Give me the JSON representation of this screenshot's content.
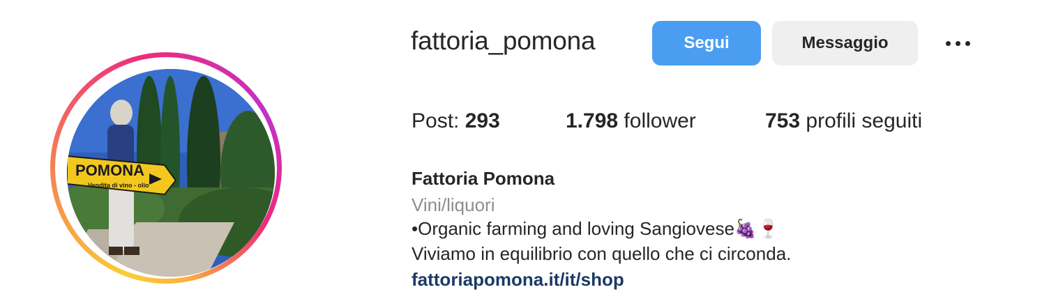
{
  "profile": {
    "username": "fattoria_pomona",
    "avatar_sign_main": "POMONA",
    "avatar_sign_sub": "Vendita di vino - olio"
  },
  "actions": {
    "follow_label": "Segui",
    "message_label": "Messaggio",
    "more_icon": "more-horizontal-icon"
  },
  "stats": {
    "posts_label": "Post:",
    "posts_count": "293",
    "followers_count": "1.798",
    "followers_label": "follower",
    "following_count": "753",
    "following_label": "profili seguiti"
  },
  "bio": {
    "name": "Fattoria Pomona",
    "category": "Vini/liquori",
    "line1": "•Organic farming and loving Sangiovese🍇🍷",
    "line2": "Viviamo in equilibrio con quello che ci circonda.",
    "link": "fattoriapomona.it/it/shop"
  },
  "colors": {
    "follow_button": "#4a9df0",
    "message_button": "#efefef",
    "link": "#1b3a66",
    "category_text": "#8e8e8e"
  }
}
